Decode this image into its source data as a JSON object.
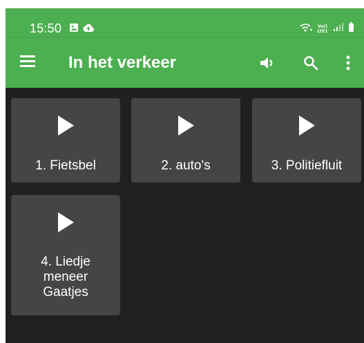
{
  "status_bar": {
    "time": "15:50",
    "left_icons": [
      "gallery-icon",
      "cloud-upload-icon"
    ],
    "right_icons": [
      "wifi-calling-icon",
      "volte-icon",
      "signal-icon",
      "battery-icon"
    ],
    "volte_text": "Vo))\nLTE1"
  },
  "app_bar": {
    "title": "In het verkeer",
    "menu_icon": "menu-icon",
    "actions": [
      "volume-icon",
      "search-icon",
      "more-vert-icon"
    ]
  },
  "sounds": [
    {
      "label": "1. Fietsbel",
      "icon": "play-icon"
    },
    {
      "label": "2. auto's",
      "icon": "play-icon"
    },
    {
      "label": "3. Politiefluit",
      "icon": "play-icon"
    },
    {
      "label": "4. Liedje meneer Gaatjes",
      "icon": "play-icon"
    }
  ],
  "colors": {
    "accent": "#4caf50",
    "background": "#202020",
    "tile": "#454545",
    "text": "#ffffff"
  }
}
